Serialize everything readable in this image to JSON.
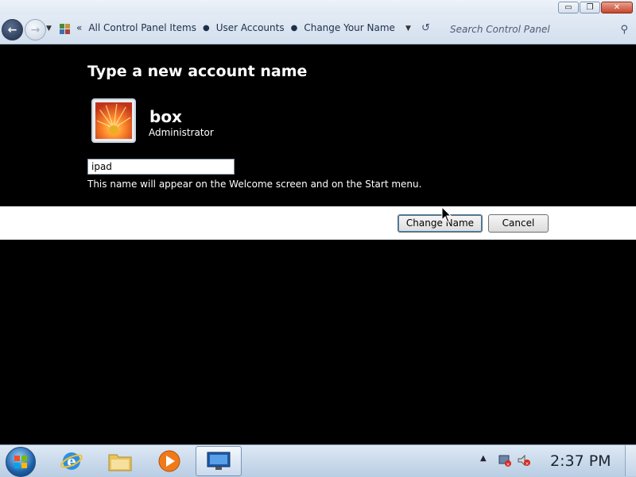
{
  "window": {
    "controls": {
      "minimize": "▭",
      "maximize": "❐",
      "close": "✕"
    }
  },
  "nav": {
    "back_icon": "back-arrow-icon",
    "forward_icon": "forward-arrow-icon",
    "overflow": "«",
    "breadcrumbs": [
      "All Control Panel Items",
      "User Accounts",
      "Change Your Name"
    ],
    "breadcrumb_separator": "●",
    "refresh_icon": "refresh-icon",
    "search_placeholder": "Search Control Panel"
  },
  "content": {
    "heading": "Type a new account name",
    "user": {
      "name": "box",
      "role": "Administrator"
    },
    "name_field": {
      "value": "ipad"
    },
    "hint": "This name will appear on the Welcome screen and on the Start menu."
  },
  "buttons": {
    "primary": "Change Name",
    "cancel": "Cancel"
  },
  "taskbar": {
    "items": [
      "internet-explorer-icon",
      "folder-icon",
      "media-player-icon",
      "control-panel-icon"
    ],
    "tray_arrow": "▲",
    "clock": "2:37 PM"
  },
  "colors": {
    "background": "#000000",
    "taskbar": "#c9d9ec",
    "accent": "#3c7fb1"
  }
}
